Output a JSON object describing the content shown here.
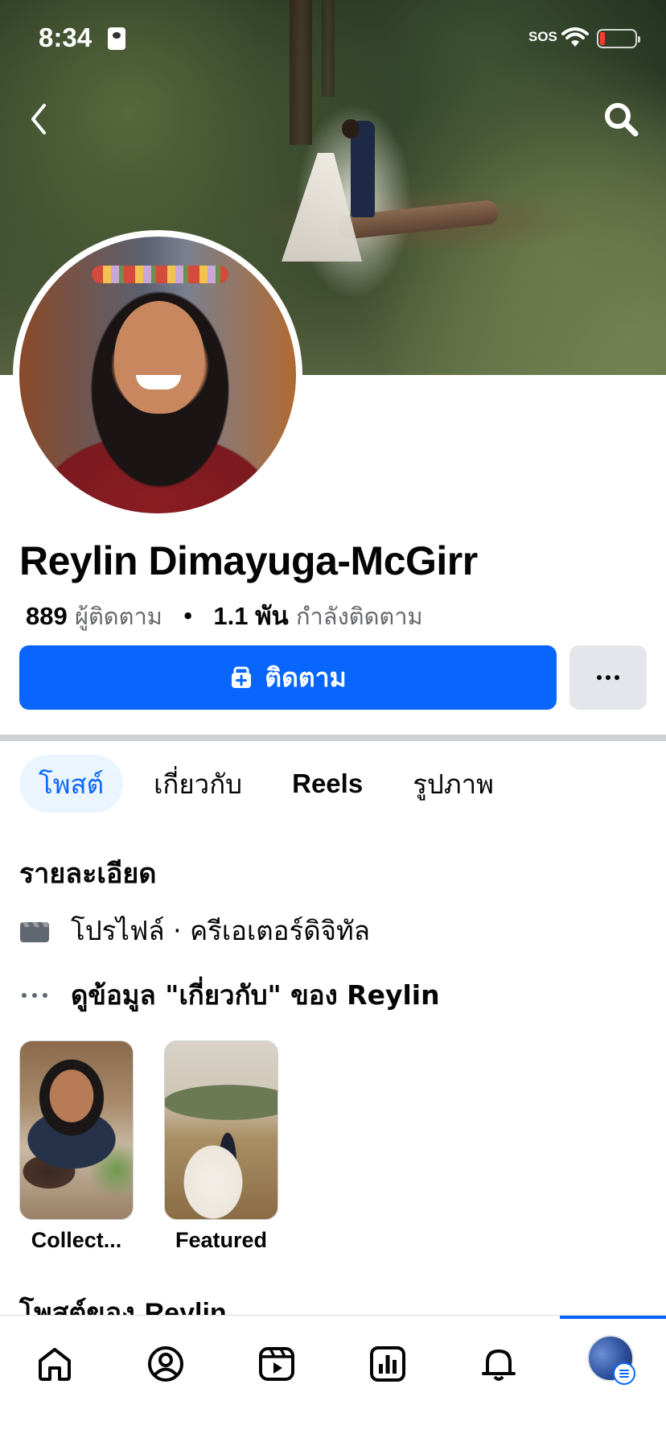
{
  "status_bar": {
    "time": "8:34",
    "sos": "SOS"
  },
  "icons": {
    "back": "chevron-left-icon",
    "search": "search-icon",
    "follow": "follow-add-icon",
    "more": "ellipsis-icon",
    "page_type": "clapperboard-icon",
    "about": "ellipsis-icon",
    "nav": [
      "home-icon",
      "profile-icon",
      "video-icon",
      "dashboard-icon",
      "bell-icon",
      "menu-avatar"
    ]
  },
  "colors": {
    "accent": "#0866ff",
    "tab_active_bg": "#ebf5ff",
    "button_secondary": "#e4e6eb",
    "text_primary": "#050505",
    "text_secondary": "#65676b"
  },
  "profile": {
    "name": "Reylin Dimayuga-McGirr",
    "followers_count": "889",
    "followers_label": "ผู้ติดตาม",
    "following_count": "1.1 พัน",
    "following_label": "กำลังติดตาม"
  },
  "actions": {
    "follow_label": "ติดตาม",
    "more_label": "···"
  },
  "tabs": [
    {
      "label": "โพสต์",
      "active": true
    },
    {
      "label": "เกี่ยวกับ",
      "active": false
    },
    {
      "label": "Reels",
      "active": false
    },
    {
      "label": "รูปภาพ",
      "active": false
    }
  ],
  "details": {
    "title": "รายละเอียด",
    "page_type_label": "โปรไฟล์",
    "page_type_value": "ครีเอเตอร์ดิจิทัล",
    "about_link": "ดูข้อมูล \"เกี่ยวกับ\" ของ Reylin"
  },
  "highlights": [
    {
      "caption": "Collect..."
    },
    {
      "caption": "Featured"
    }
  ],
  "posts_heading": {
    "prefix": "โพสต์ของ",
    "name": "Reylin"
  }
}
